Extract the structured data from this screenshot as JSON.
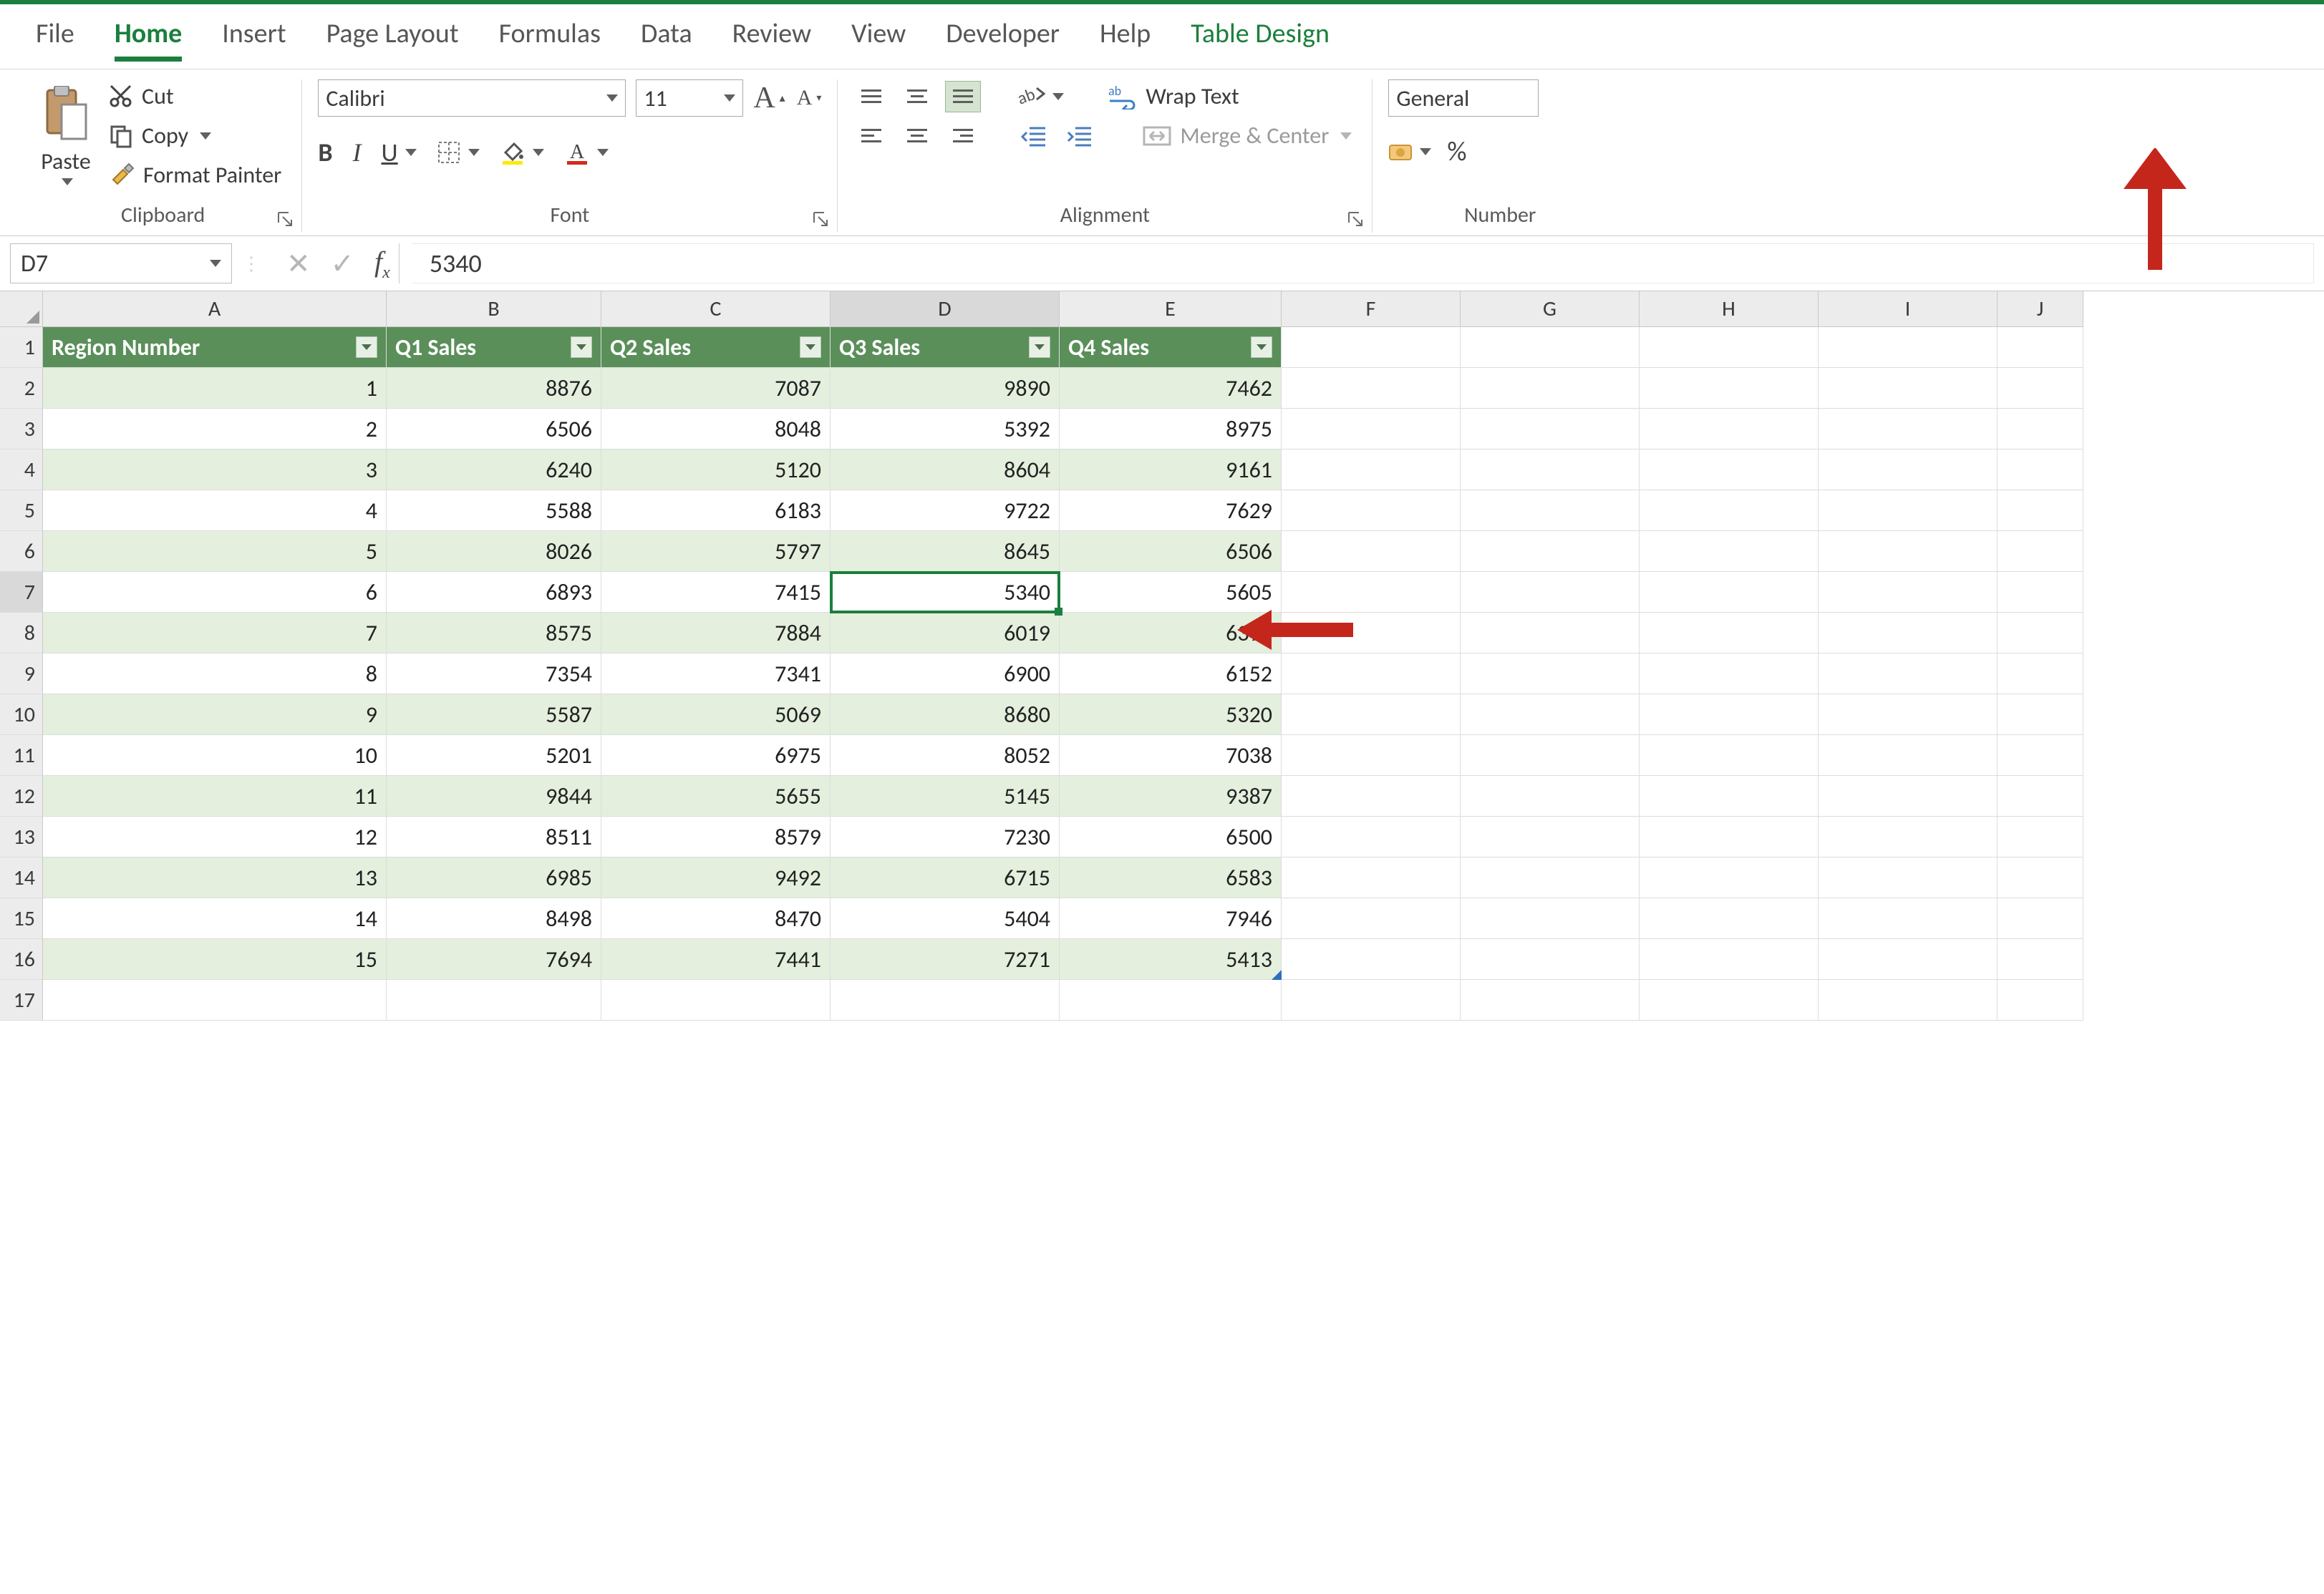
{
  "tabs": [
    "File",
    "Home",
    "Insert",
    "Page Layout",
    "Formulas",
    "Data",
    "Review",
    "View",
    "Developer",
    "Help",
    "Table Design"
  ],
  "active_tab": "Home",
  "highlight_tab": "Table Design",
  "ribbon": {
    "clipboard": {
      "label": "Clipboard",
      "paste": "Paste",
      "cut": "Cut",
      "copy": "Copy",
      "format_painter": "Format Painter"
    },
    "font": {
      "label": "Font",
      "name": "Calibri",
      "size": "11",
      "bold": "B",
      "italic": "I",
      "underline": "U"
    },
    "alignment": {
      "label": "Alignment",
      "wrap": "Wrap Text",
      "merge": "Merge & Center"
    },
    "number": {
      "label": "Number",
      "format": "General",
      "percent": "%"
    }
  },
  "namebox": "D7",
  "formula": "5340",
  "columns": [
    "A",
    "B",
    "C",
    "D",
    "E",
    "F",
    "G",
    "H",
    "I",
    "J"
  ],
  "col_widths": [
    "cA",
    "cB",
    "cC",
    "cD",
    "cE",
    "cF",
    "cG",
    "cH",
    "cI",
    "cJ"
  ],
  "selected_col": "D",
  "selected_row": 7,
  "r1": 1,
  "r2": 2,
  "r3": 3,
  "r4": 4,
  "r5": 5,
  "r6": 6,
  "r7": 7,
  "r8": 8,
  "r9": 9,
  "r10": 10,
  "r11": 11,
  "r12": 12,
  "r13": 13,
  "r14": 14,
  "r15": 15,
  "r16": 16,
  "r17": 17,
  "thead": [
    "Region Number",
    "Q1 Sales",
    "Q2 Sales",
    "Q3 Sales",
    "Q4 Sales"
  ],
  "chart_data": {
    "type": "table",
    "columns": [
      "Region Number",
      "Q1 Sales",
      "Q2 Sales",
      "Q3 Sales",
      "Q4 Sales"
    ],
    "rows": [
      [
        1,
        8876,
        7087,
        9890,
        7462
      ],
      [
        2,
        6506,
        8048,
        5392,
        8975
      ],
      [
        3,
        6240,
        5120,
        8604,
        9161
      ],
      [
        4,
        5588,
        6183,
        9722,
        7629
      ],
      [
        5,
        8026,
        5797,
        8645,
        6506
      ],
      [
        6,
        6893,
        7415,
        5340,
        5605
      ],
      [
        7,
        8575,
        7884,
        6019,
        6399
      ],
      [
        8,
        7354,
        7341,
        6900,
        6152
      ],
      [
        9,
        5587,
        5069,
        8680,
        5320
      ],
      [
        10,
        5201,
        6975,
        8052,
        7038
      ],
      [
        11,
        9844,
        5655,
        5145,
        9387
      ],
      [
        12,
        8511,
        8579,
        7230,
        6500
      ],
      [
        13,
        6985,
        9492,
        6715,
        6583
      ],
      [
        14,
        8498,
        8470,
        5404,
        7946
      ],
      [
        15,
        7694,
        7441,
        7271,
        5413
      ]
    ]
  }
}
